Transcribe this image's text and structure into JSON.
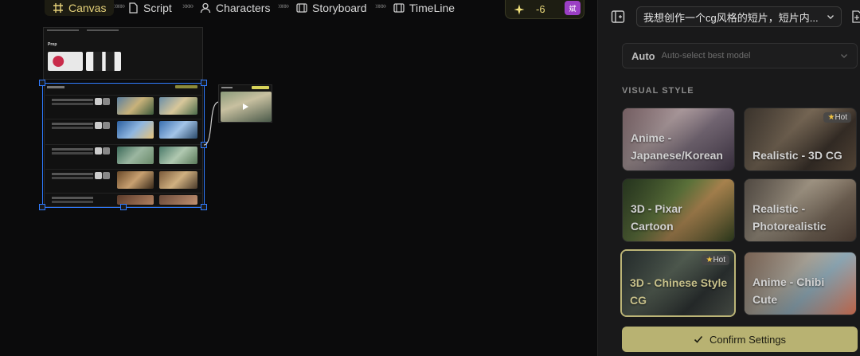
{
  "nav": {
    "canvas": "Canvas",
    "script": "Script",
    "characters": "Characters",
    "storyboard": "Storyboard",
    "timeline": "TimeLine",
    "separator": "»»»"
  },
  "credits": {
    "value": "-6",
    "avatar": "斌"
  },
  "canvas": {
    "prop_label": "Prop"
  },
  "panel": {
    "prompt": "我想创作一个cg风格的短片，短片内...",
    "model_label": "Auto",
    "model_hint": "Auto-select best model",
    "section_title": "VISUAL STYLE",
    "styles": [
      {
        "line1": "Anime -",
        "line2": "Japanese/Korean",
        "badge": ""
      },
      {
        "line1": "Realistic - 3D CG",
        "line2": "",
        "badge": "Hot"
      },
      {
        "line1": "3D - Pixar",
        "line2": "Cartoon",
        "badge": ""
      },
      {
        "line1": "Realistic -",
        "line2": "Photorealistic",
        "badge": ""
      },
      {
        "line1": "3D - Chinese Style",
        "line2": "CG",
        "badge": "Hot"
      },
      {
        "line1": "Anime - Chibi",
        "line2": "Cute",
        "badge": ""
      }
    ],
    "confirm_label": "Confirm Settings"
  },
  "colors": {
    "accent": "#b8b272",
    "selection": "#2f7bff",
    "avatar": "#9b3fc4"
  }
}
